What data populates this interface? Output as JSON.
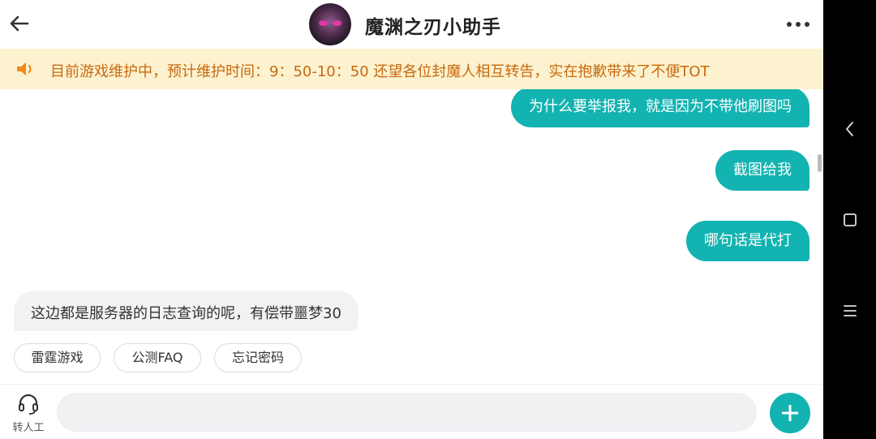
{
  "header": {
    "title": "魔渊之刃小助手"
  },
  "notice": {
    "text": "目前游戏维护中，预计维护时间：9：50-10：50 还望各位封魔人相互转告，实在抱歉带来了不便TOT"
  },
  "messages": {
    "out1": "为什么要举报我，就是因为不带他刷图吗",
    "out2": "截图给我",
    "out3": "哪句话是代打",
    "in1": "这边都是服务器的日志查询的呢，有偿带噩梦30"
  },
  "quick_replies": [
    "雷霆游戏",
    "公测FAQ",
    "忘记密码"
  ],
  "bottom": {
    "agent_label": "转人工",
    "input_placeholder": ""
  },
  "colors": {
    "accent": "#12b3b0",
    "notice_bg": "#fdf2cf",
    "notice_text": "#c8690f"
  },
  "icons": {
    "back": "back-arrow-icon",
    "more": "more-dots-icon",
    "notice": "speaker-icon",
    "agent": "headset-icon",
    "plus": "plus-icon",
    "nav_back": "chevron-left-icon",
    "nav_home": "square-icon",
    "nav_menu": "menu-icon"
  }
}
